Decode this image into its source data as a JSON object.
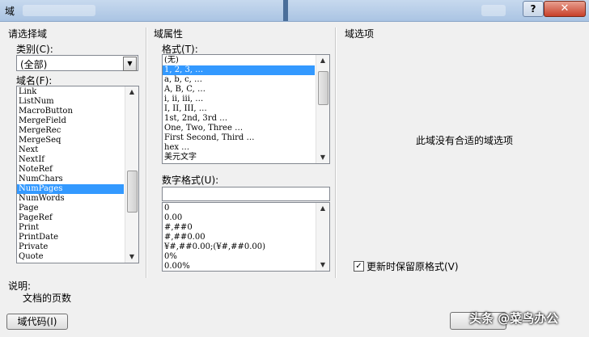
{
  "window": {
    "title": "域"
  },
  "left": {
    "group_title": "请选择域",
    "category_label": "类别(C):",
    "category_value": "(全部)",
    "fieldname_label": "域名(F):",
    "fields": [
      "Link",
      "ListNum",
      "MacroButton",
      "MergeField",
      "MergeRec",
      "MergeSeq",
      "Next",
      "NextIf",
      "NoteRef",
      "NumChars",
      "NumPages",
      "NumWords",
      "Page",
      "PageRef",
      "Print",
      "PrintDate",
      "Private",
      "Quote"
    ],
    "selected_field": "NumPages"
  },
  "middle": {
    "group_title": "域属性",
    "format_label": "格式(T):",
    "formats": [
      "(无)",
      "1, 2, 3, …",
      "a, b, c, …",
      "A, B, C, …",
      "i, ii, iii, …",
      "I, II, III, …",
      "1st, 2nd, 3rd …",
      "One, Two, Three …",
      "First Second, Third …",
      "hex …",
      "美元文字"
    ],
    "selected_format": "1, 2, 3, …",
    "number_format_label": "数字格式(U):",
    "number_format_value": "",
    "number_formats": [
      "0",
      "0.00",
      "#,##0",
      "#,##0.00",
      "¥#,##0.00;(¥#,##0.00)",
      "0%",
      "0.00%"
    ]
  },
  "right": {
    "group_title": "域选项",
    "no_options_text": "此域没有合适的域选项",
    "preserve_format_label": "更新时保留原格式(V)",
    "preserve_format_checked": true
  },
  "description": {
    "label": "说明:",
    "text": "文档的页数"
  },
  "buttons": {
    "field_codes": "域代码(I)",
    "watermark": "头条 @菜鸟办公"
  },
  "icons": {
    "help": "help-icon",
    "close": "close-icon",
    "help_glyph": "?",
    "close_glyph": "✕"
  }
}
